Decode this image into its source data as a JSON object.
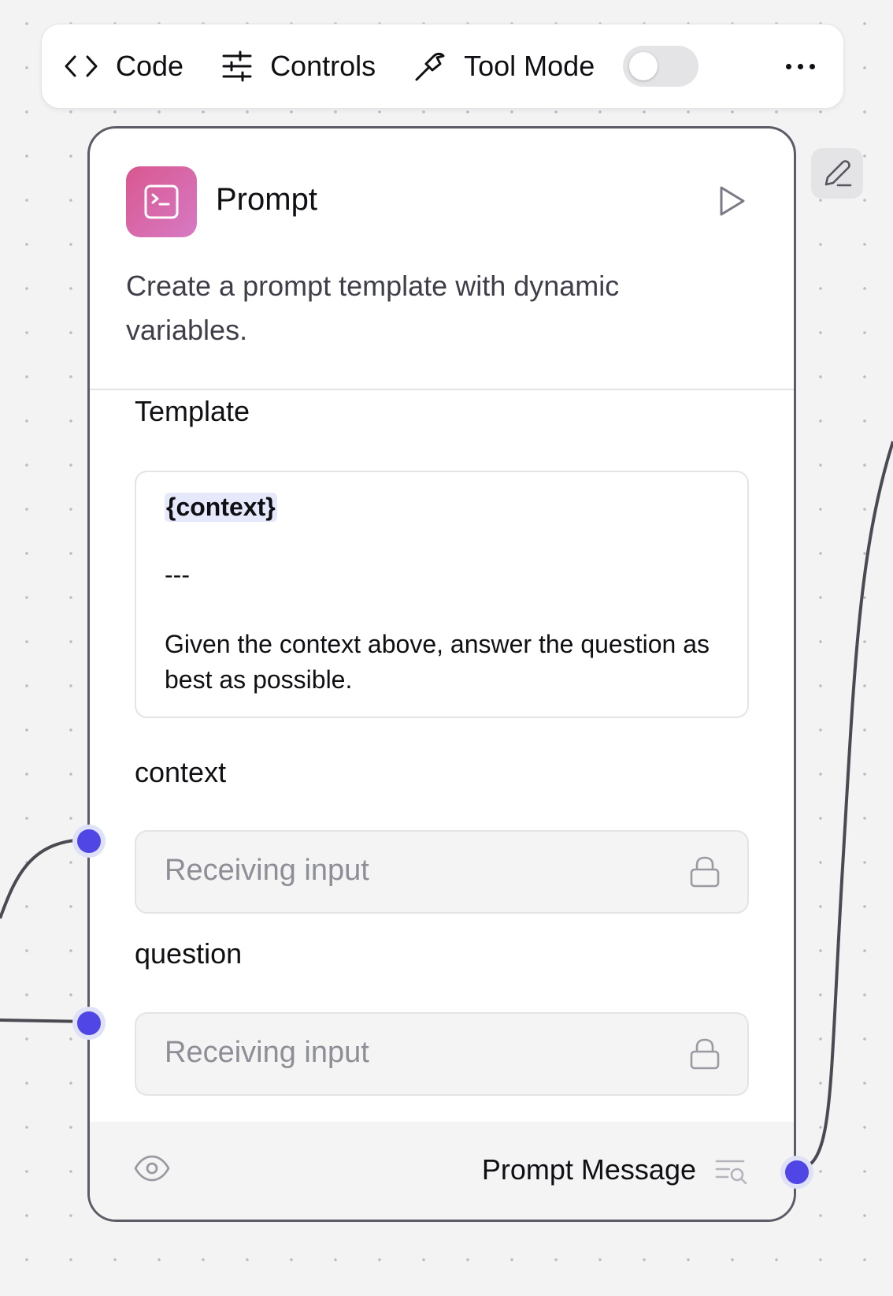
{
  "toolbar": {
    "code_label": "Code",
    "controls_label": "Controls",
    "tool_mode_label": "Tool Mode",
    "tool_mode_enabled": false
  },
  "node": {
    "title": "Prompt",
    "description": "Create a prompt template with dynamic variables.",
    "icon_gradient": [
      "#d8578f",
      "#d77ac4"
    ],
    "template": {
      "label": "Template",
      "variable": "{context}",
      "separator": "---",
      "body": "Given the context above, answer the question as best as possible."
    },
    "fields": [
      {
        "label": "context",
        "placeholder": "Receiving input"
      },
      {
        "label": "question",
        "placeholder": "Receiving input"
      }
    ],
    "output": {
      "label": "Prompt Message"
    }
  },
  "colors": {
    "handle": "#4f46e5",
    "card_border": "#5c5c66",
    "canvas_bg": "#f3f3f4"
  }
}
